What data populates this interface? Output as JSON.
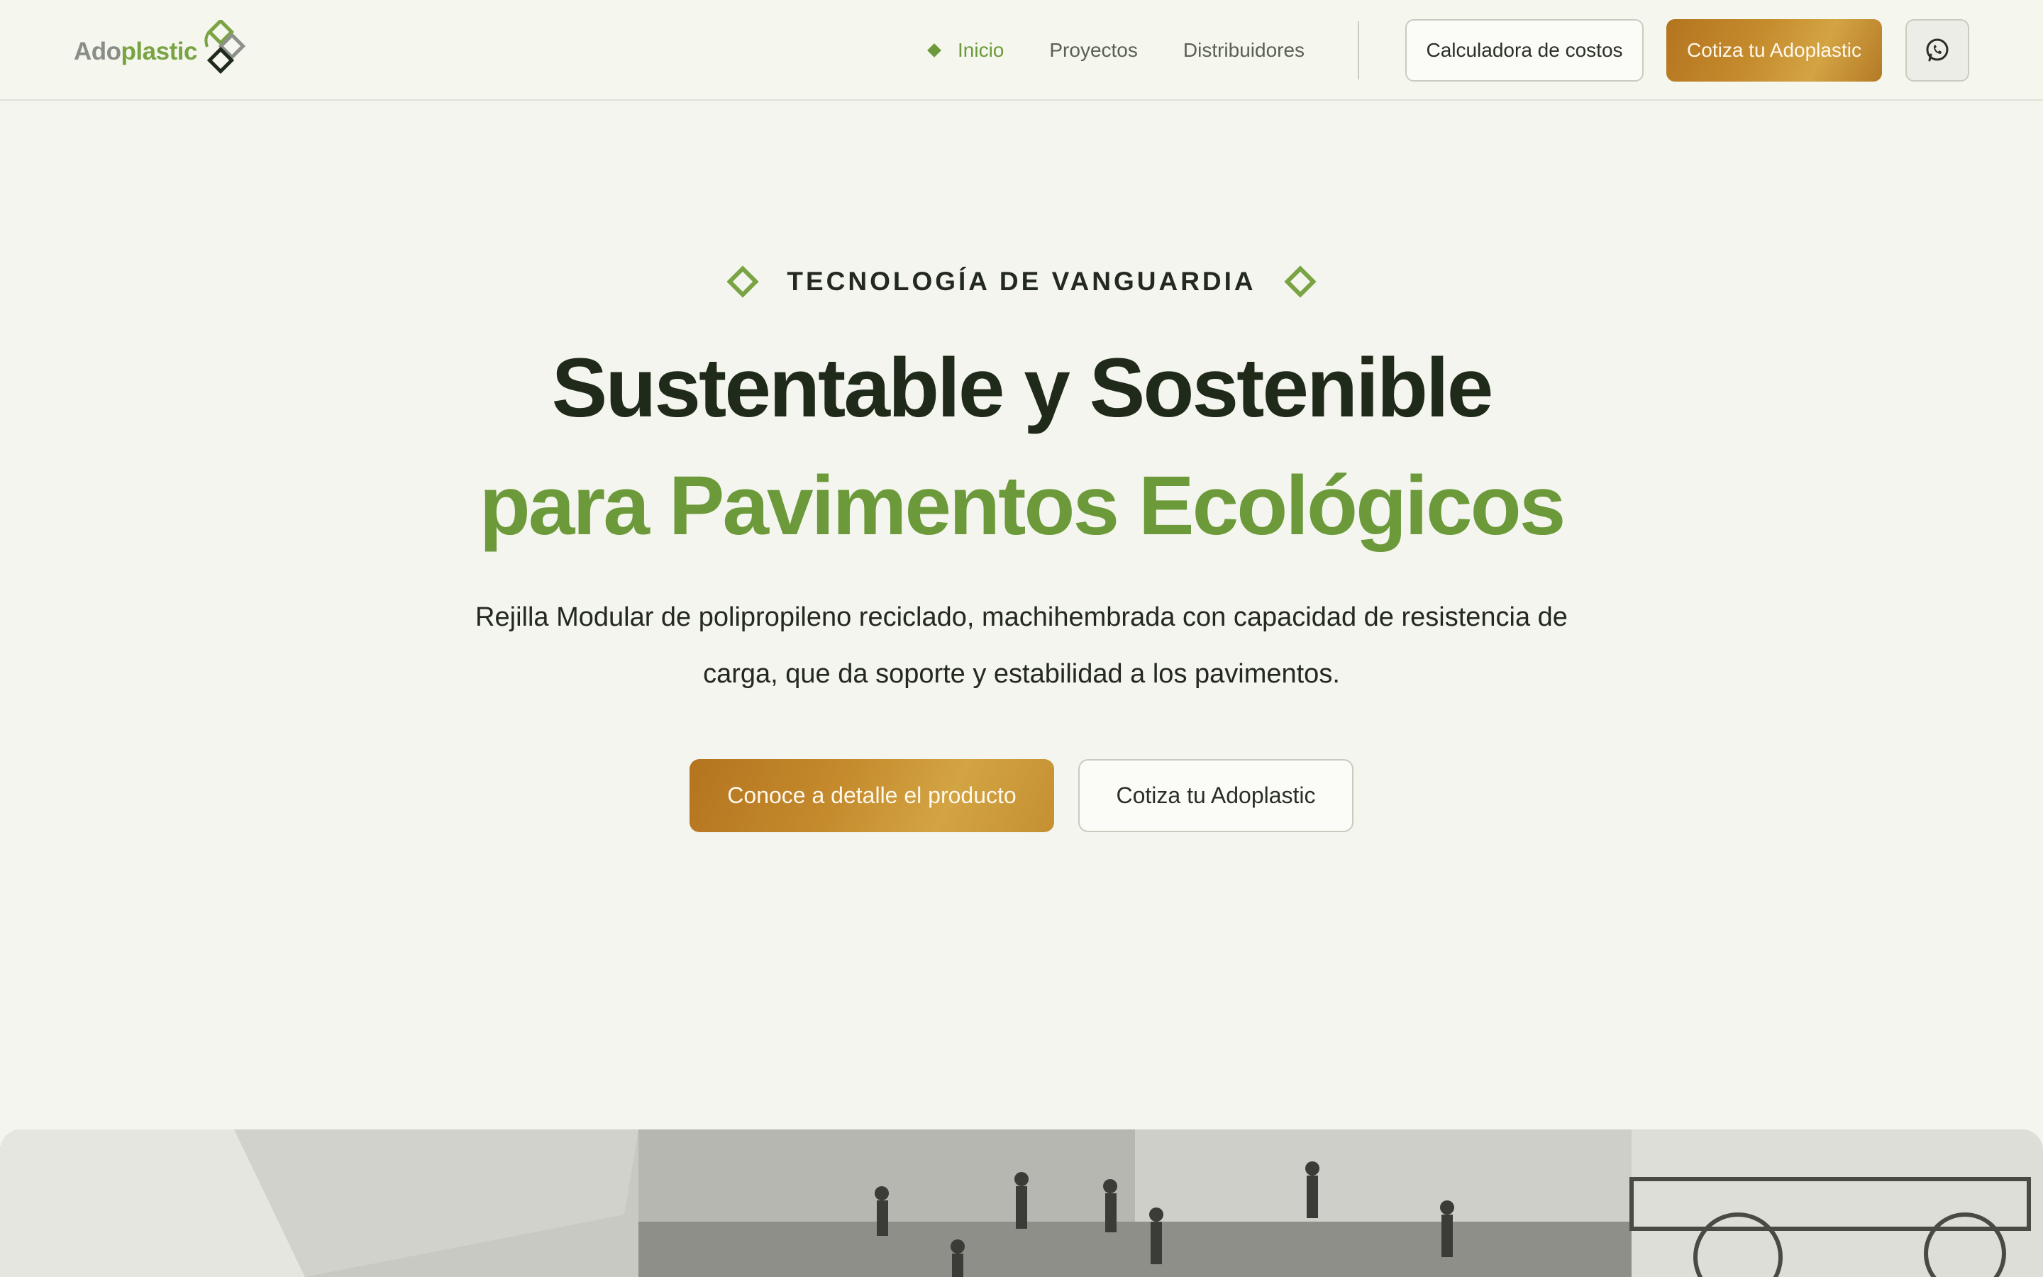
{
  "brand": {
    "name_part_1": "Ado",
    "name_part_2": "plastic",
    "accent_color": "#6c9a3a",
    "gold_color": "#c48a2c"
  },
  "nav": {
    "links": [
      {
        "label": "Inicio",
        "active": true
      },
      {
        "label": "Proyectos",
        "active": false
      },
      {
        "label": "Distribuidores",
        "active": false
      }
    ],
    "calculator_label": "Calculadora de costos",
    "quote_label": "Cotiza tu Adoplastic",
    "whatsapp_icon": "whatsapp-icon"
  },
  "hero": {
    "eyebrow": "TECNOLOGÍA DE VANGUARDIA",
    "title_line_1": "Sustentable y Sostenible",
    "title_line_2": "para Pavimentos Ecológicos",
    "subtitle": "Rejilla Modular de polipropileno reciclado, machihembrada con capacidad de resistencia de carga, que da soporte y estabilidad a los pavimentos.",
    "primary_cta": "Conoce a detalle el producto",
    "secondary_cta": "Cotiza tu Adoplastic"
  }
}
